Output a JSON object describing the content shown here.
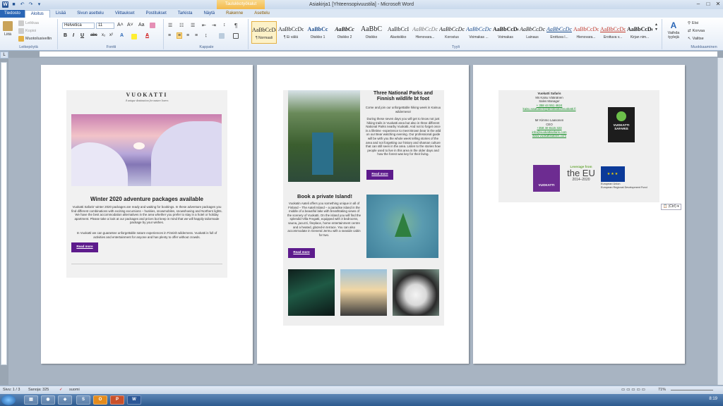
{
  "window": {
    "title": "Asiakirja1 [Yhteensopivuustila] - Microsoft Word",
    "contextual_tab_group": "Taulukkotyökalut"
  },
  "tabs": [
    "Tiedosto",
    "Aloitus",
    "Lisää",
    "Sivun asettelu",
    "Viittaukset",
    "Postitukset",
    "Tarkista",
    "Näytä",
    "Rakenne",
    "Asettelu"
  ],
  "ribbon": {
    "clipboard": {
      "label": "Leikepöytä",
      "paste": "Liitä",
      "cut": "Leikkaa",
      "copy": "Kopioi",
      "format_painter": "Muotoilusivellin"
    },
    "font": {
      "label": "Fontti",
      "family": "Helvetica",
      "size": "11"
    },
    "paragraph": {
      "label": "Kappale"
    },
    "styles": {
      "label": "Tyyli",
      "items": [
        {
          "sample": "AaBbCcDc",
          "name": "¶ Normaali"
        },
        {
          "sample": "AaBbCcDc",
          "name": "¶ Ei väliä"
        },
        {
          "sample": "AaBbCc",
          "name": "Otsikko 1"
        },
        {
          "sample": "AaBbCc",
          "name": "Otsikko 2"
        },
        {
          "sample": "AaBbC",
          "name": "Otsikko"
        },
        {
          "sample": "AaBbCcI",
          "name": "Alaotsikko"
        },
        {
          "sample": "AaBbCcDc",
          "name": "Hienovara..."
        },
        {
          "sample": "AaBbCcDc",
          "name": "Korostus"
        },
        {
          "sample": "AaBbCcDc",
          "name": "Voimakas ..."
        },
        {
          "sample": "AaBbCcDc",
          "name": "Voimakas"
        },
        {
          "sample": "AaBbCcDc",
          "name": "Lainaus"
        },
        {
          "sample": "AaBbCcDc",
          "name": "Erottuva l..."
        },
        {
          "sample": "AaBbCcDc",
          "name": "Hienovara..."
        },
        {
          "sample": "AaBbCcDc",
          "name": "Erottuva v..."
        },
        {
          "sample": "AaBbCcDc",
          "name": "Kirjan nim..."
        }
      ],
      "change_styles": "Vaihda tyylejä"
    },
    "editing": {
      "label": "Muokkaaminen",
      "find": "Etsi",
      "replace": "Korvaa",
      "select": "Valitse"
    }
  },
  "page1": {
    "brand": "VUOKATTI",
    "tagline": "A unique destination for nature lovers",
    "heading": "Winter 2020 adventure packages available",
    "para1": "Vuokatti Safaris' winter 2020 packages are ready and waiting for bookings. In these adventure packages you find different combinations with exciting excursions – huskies, snowmobiles, snowshoeing and Northern lights. We have the best accommodation alternatives in the area whether you prefer to stay in a hotel or holiday apartment. Please take a look at our packages and prices but keep in mind that we will happily tailormade package by your wishes.",
    "para2": "In Vuokatti we can guarantee unforgettable nature experiences in Finnish wilderness. Vuokatti is full of activities and entertainment for anyone and has plenty to offer without crowds.",
    "button": "Read more"
  },
  "page2": {
    "heading1": "Three National Parks and Finnish wildlife bt foot",
    "intro": "Come and join our unforgettable hiking week in Kainuu wilderness!",
    "para1": "During these seven days you will get to know not just hiking trails in Vuokatti area but also in three different National Parks nearby Vuokatti. And not to forget once in a lifetime -experience to meet Brown bear in the wild on our Bear watching evening. Our professional guide will be with you the whole week telling stories of the area and not forgetting our history and shaman culture that can still seen in the area. Listen to the stories how people used to live in this area in the older days and how the forest was key for their living.",
    "button1": "Read more",
    "heading2": "Book a private Island!",
    "para2": "Vuokatin Aateli offers you something unique in all of Finland – The Aateli Island – a paradise island in the middle of a beautiful lake with breathtaking views of the scenery of Vuokatti. On the island you will find the splendid Villa Fregatti, equipped with 3 bedrooms, sauna, jacuzzi, fireplace, home entertainment centre and a heated, glazed-in terrace. You can also accommodate in General Jermu with a seaside cabin for two.",
    "button2": "Read more"
  },
  "page3": {
    "company": "Vuokatti Safaris",
    "name1": "Ms Kaisu Väänänen",
    "title1": "Sales Manager",
    "phone1": "+ 358 44 551 4624",
    "email1": "kaisu.vaananen@destinationvuokatti.fi",
    "name2": "Mr Kimmo Laasonen",
    "title2": "CEO",
    "phone2": "+358 40 8115 323",
    "email2": "info@vuokattisafaris.com",
    "web": "www.vuokattisafaris.com",
    "safari_logo": "VUOKATTI SAFARIS",
    "vk_logo": "VUOKATTI",
    "leverage": "Leverage from",
    "the_eu": "the EU",
    "years": "2014–2020",
    "eu_caption1": "European Union",
    "eu_caption2": "European Regional Development Fund",
    "paste_options": "(Ctrl)"
  },
  "status": {
    "page": "Sivu: 1 / 3",
    "words": "Sanoja: 325",
    "language": "suomi",
    "zoom": "71%"
  },
  "taskbar": {
    "clock": "8:19"
  },
  "colors": {
    "accent_purple": "#5d1b8c",
    "ribbon_blue": "#2a66b6",
    "link_green": "#1a8f2a"
  }
}
